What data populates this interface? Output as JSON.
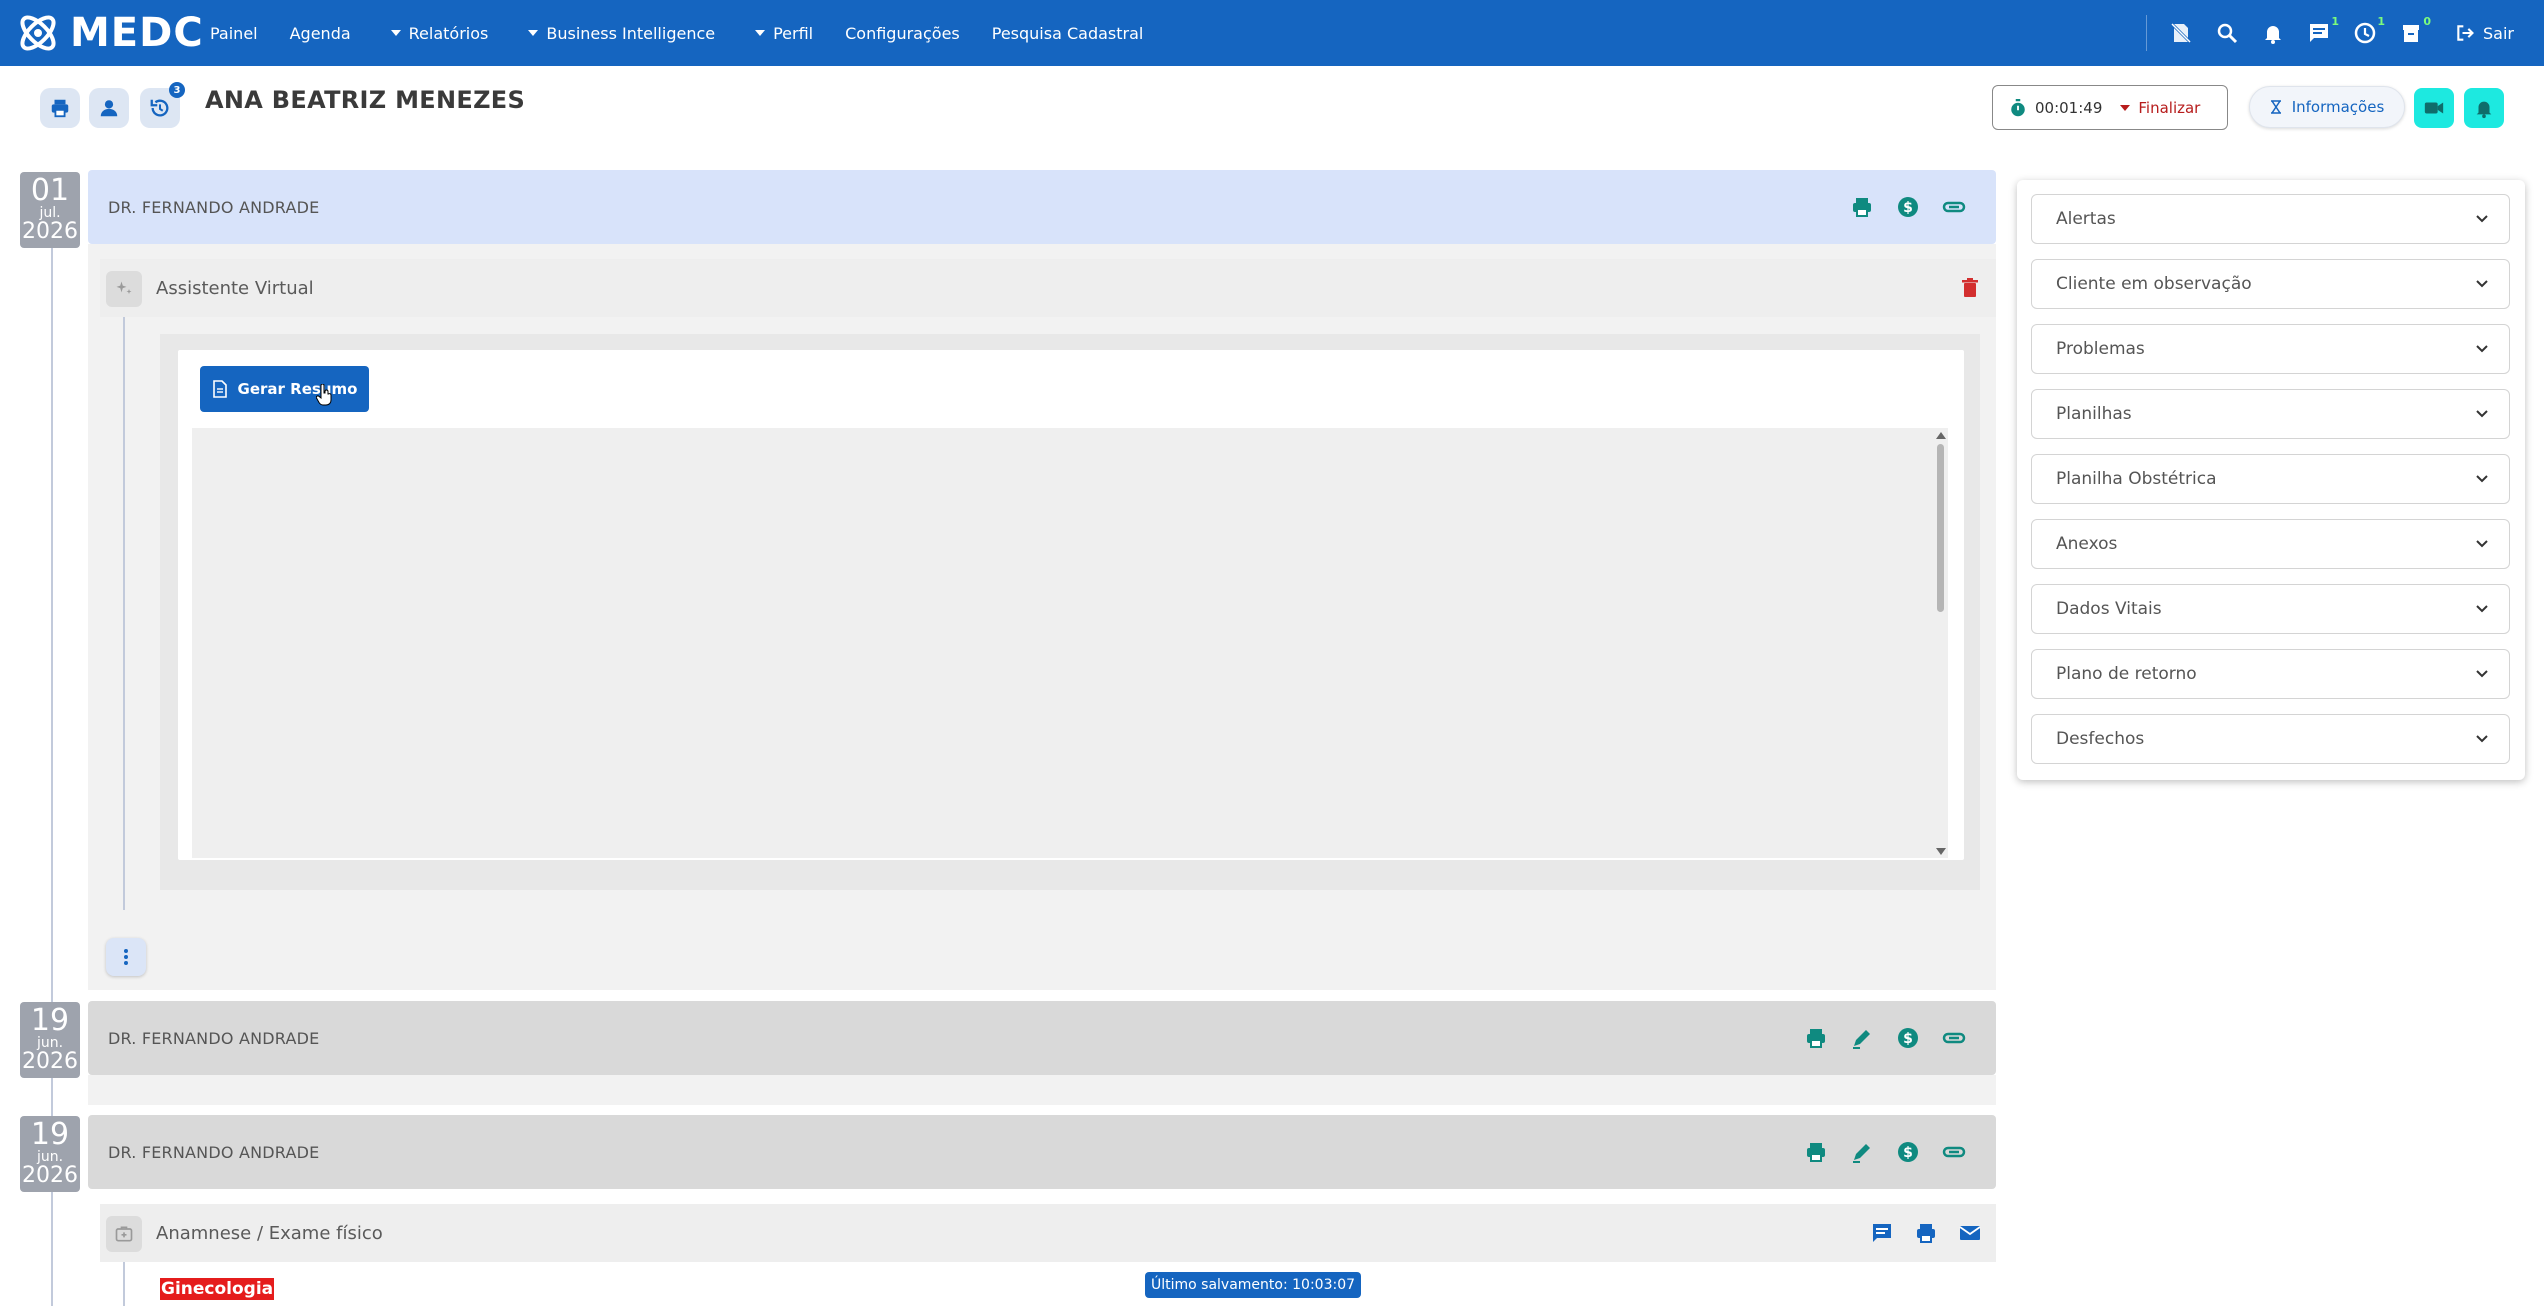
{
  "app": {
    "logo_text": "MEDC",
    "menu": [
      {
        "label": "Painel"
      },
      {
        "label": "Agenda"
      },
      {
        "label": "Relatórios"
      },
      {
        "label": "Business Intelligence"
      },
      {
        "label": "Perfil"
      },
      {
        "label": "Configurações"
      },
      {
        "label": "Pesquisa Cadastral"
      }
    ],
    "badges": {
      "messages": "1",
      "clock": "1",
      "archive": "0"
    },
    "logout_label": "Sair"
  },
  "patient": {
    "name": "ANA BEATRIZ MENEZES",
    "history_badge": "3",
    "timer": "00:01:49",
    "finalize_label": "Finalizar",
    "info_label": "Informações"
  },
  "timeline": [
    {
      "day": "01",
      "month": "jul.",
      "year": "2026",
      "doctor": "DR. FERNANDO ANDRADE",
      "section_title": "Assistente Virtual",
      "button_label": "Gerar Resumo"
    },
    {
      "day": "19",
      "month": "jun.",
      "year": "2026",
      "doctor": "DR. FERNANDO ANDRADE"
    },
    {
      "day": "19",
      "month": "jun.",
      "year": "2026",
      "doctor": "DR. FERNANDO ANDRADE",
      "section_title": "Anamnese / Exame físico",
      "tag": "Ginecologia",
      "save_status": "Último salvamento: 10:03:07"
    }
  ],
  "side_panel": {
    "items": [
      {
        "label": "Alertas"
      },
      {
        "label": "Cliente em observação"
      },
      {
        "label": "Problemas"
      },
      {
        "label": "Planilhas"
      },
      {
        "label": "Planilha Obstétrica"
      },
      {
        "label": "Anexos"
      },
      {
        "label": "Dados Vitais"
      },
      {
        "label": "Plano de retorno"
      },
      {
        "label": "Desfechos"
      }
    ]
  },
  "colors": {
    "primary": "#1565c0",
    "accent_cyan": "#1de9e0",
    "teal_icon": "#0f8a80",
    "danger": "#b71c1c",
    "timeline_active": "#d8e3fa",
    "timeline_grey": "#d9d9d9"
  }
}
